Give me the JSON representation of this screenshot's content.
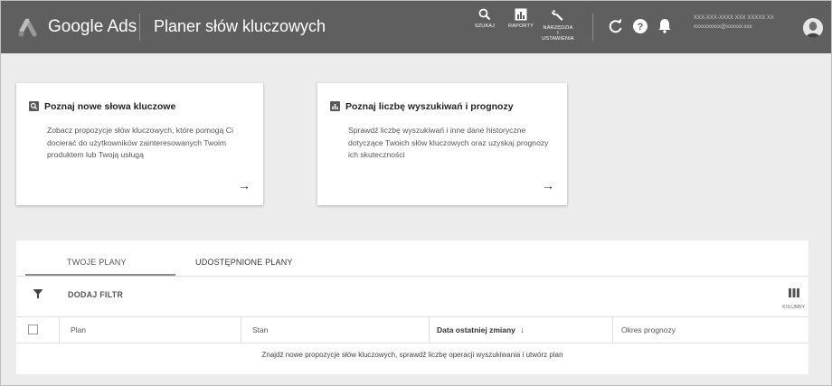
{
  "header": {
    "brand": "Google Ads",
    "page_title": "Planer słów kluczowych",
    "tools": [
      {
        "label": "SZUKAJ",
        "icon": "search-icon"
      },
      {
        "label": "RAPORTY",
        "icon": "reports-icon"
      },
      {
        "label": "NARZĘDZIA",
        "label2": "I",
        "label3": "USTAWIENIA",
        "icon": "wrench-icon"
      }
    ],
    "account_line1": "XXX-XXX-XXXX XXX XXXXX XX",
    "account_line2": "xxxxxxxxxx@xxxxxx.xxx"
  },
  "cards": [
    {
      "title": "Poznaj nowe słowa kluczowe",
      "desc": "Zobacz propozycje słów kluczowych, które pomogą Ci docierać do użytkowników zainteresowanych Twoim produktem lub Twoją usługą",
      "arrow": "→",
      "icon": "search-badge-icon"
    },
    {
      "title": "Poznaj liczbę wyszukiwań i prognozy",
      "desc": "Sprawdź liczbę wyszukiwań i inne dane historyczne dotyczące Twoich słów kluczowych oraz uzyskaj prognozy ich skuteczności",
      "arrow": "→",
      "icon": "chart-badge-icon"
    }
  ],
  "plans": {
    "tabs": [
      "TWOJE PLANY",
      "UDOSTĘPNIONE PLANY"
    ],
    "filter_label": "DODAJ FILTR",
    "columns_label": "KOLUMNY",
    "table_headers": [
      "Plan",
      "Stan",
      "Data ostatniej zmiany",
      "Okres prognozy"
    ],
    "sort_arrow": "↓",
    "empty_message": "Znajdź nowe propozycje słów kluczowych, sprawdź liczbę operacji wyszukiwania i utwórz plan"
  },
  "colors": {
    "topbar": "#5f5f5f",
    "background": "#ececec",
    "card": "#ffffff"
  }
}
